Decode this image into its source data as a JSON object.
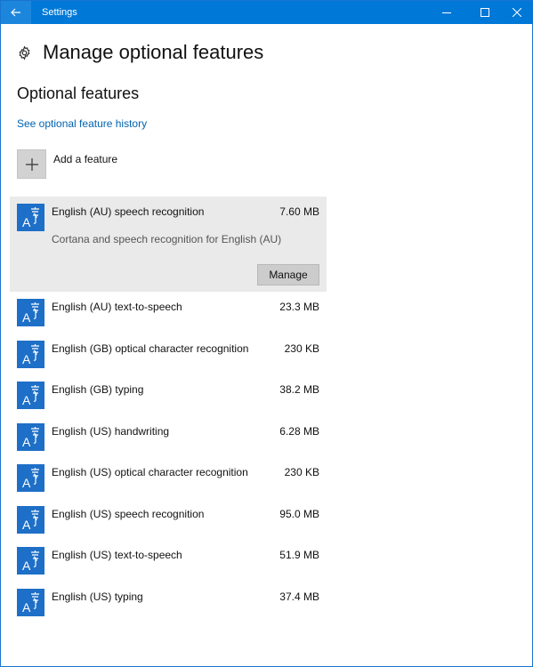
{
  "window": {
    "title": "Settings"
  },
  "page": {
    "title": "Manage optional features",
    "icon": "gear-icon"
  },
  "section": {
    "title": "Optional features",
    "history_link": "See optional feature history",
    "add_feature_label": "Add a feature"
  },
  "features": [
    {
      "name": "English (AU) speech recognition",
      "size": "7.60 MB",
      "description": "Cortana and speech recognition for English (AU)",
      "action": "Manage",
      "selected": true
    },
    {
      "name": "English (AU) text-to-speech",
      "size": "23.3 MB"
    },
    {
      "name": "English (GB) optical character recognition",
      "size": "230 KB"
    },
    {
      "name": "English (GB) typing",
      "size": "38.2 MB"
    },
    {
      "name": "English (US) handwriting",
      "size": "6.28 MB"
    },
    {
      "name": "English (US) optical character recognition",
      "size": "230 KB"
    },
    {
      "name": "English (US) speech recognition",
      "size": "95.0 MB"
    },
    {
      "name": "English (US) text-to-speech",
      "size": "51.9 MB"
    },
    {
      "name": "English (US) typing",
      "size": "37.4 MB"
    }
  ],
  "colors": {
    "titlebar": "#0078d7",
    "link": "#0063b1",
    "feature_icon": "#1e6fc7",
    "selected_row": "#eaeaea"
  }
}
